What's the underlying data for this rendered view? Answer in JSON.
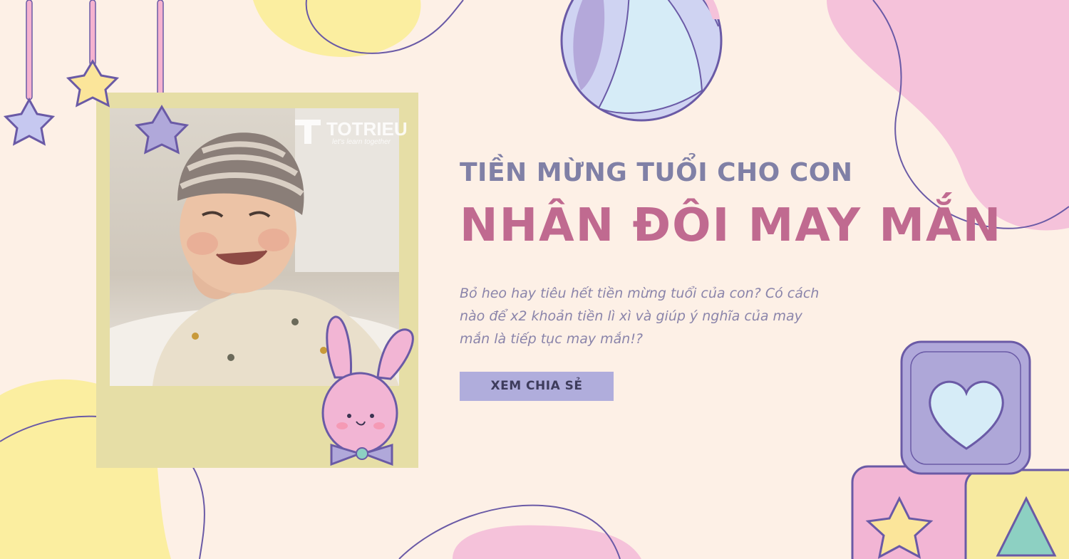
{
  "banner": {
    "heading_small": "TIỀN MỪNG TUỔI CHO CON",
    "heading_big": "NHÂN ĐÔI MAY MẮN",
    "description": "Bỏ heo hay tiêu hết tiền mừng tuổi của con? Có cách nào để x2 khoản tiền lì xì và giúp ý nghĩa của may mắn là tiếp tục may mắn!?",
    "cta_label": "XEM CHIA SẺ"
  },
  "watermark": {
    "brand": "TOTRIEU",
    "tagline": "let's learn together"
  },
  "colors": {
    "background": "#fdf0e6",
    "heading_small": "#8080a6",
    "heading_big": "#c06a90",
    "description": "#8a84aa",
    "cta_background": "#b0addc",
    "pink_blob": "#f5c2da",
    "yellow_blob": "#fbeea0",
    "outline": "#6a5aa6"
  }
}
